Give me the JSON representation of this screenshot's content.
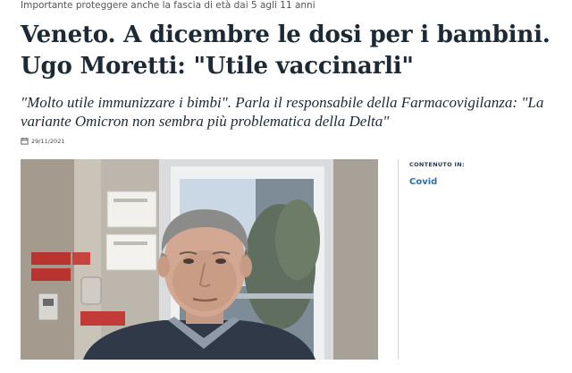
{
  "article": {
    "kicker": "Importante proteggere anche la fascia di età dai 5 agli 11 anni",
    "headline": "Veneto. A dicembre le dosi per i bambini. Ugo Moretti: \"Utile vaccinarli\"",
    "subtitle": "\"Molto utile immunizzare i bimbi\". Parla il responsabile della Farmacovigilanza: \"La variante Omicron non sembra più problematica della Delta\"",
    "date": "29/11/2021",
    "date_icon": "calendar-icon"
  },
  "sidebar": {
    "label": "CONTENUTO IN:",
    "topic_link": "Covid",
    "link_color": "#2b6fb3"
  },
  "photo": {
    "subject": "portrait-photo"
  }
}
